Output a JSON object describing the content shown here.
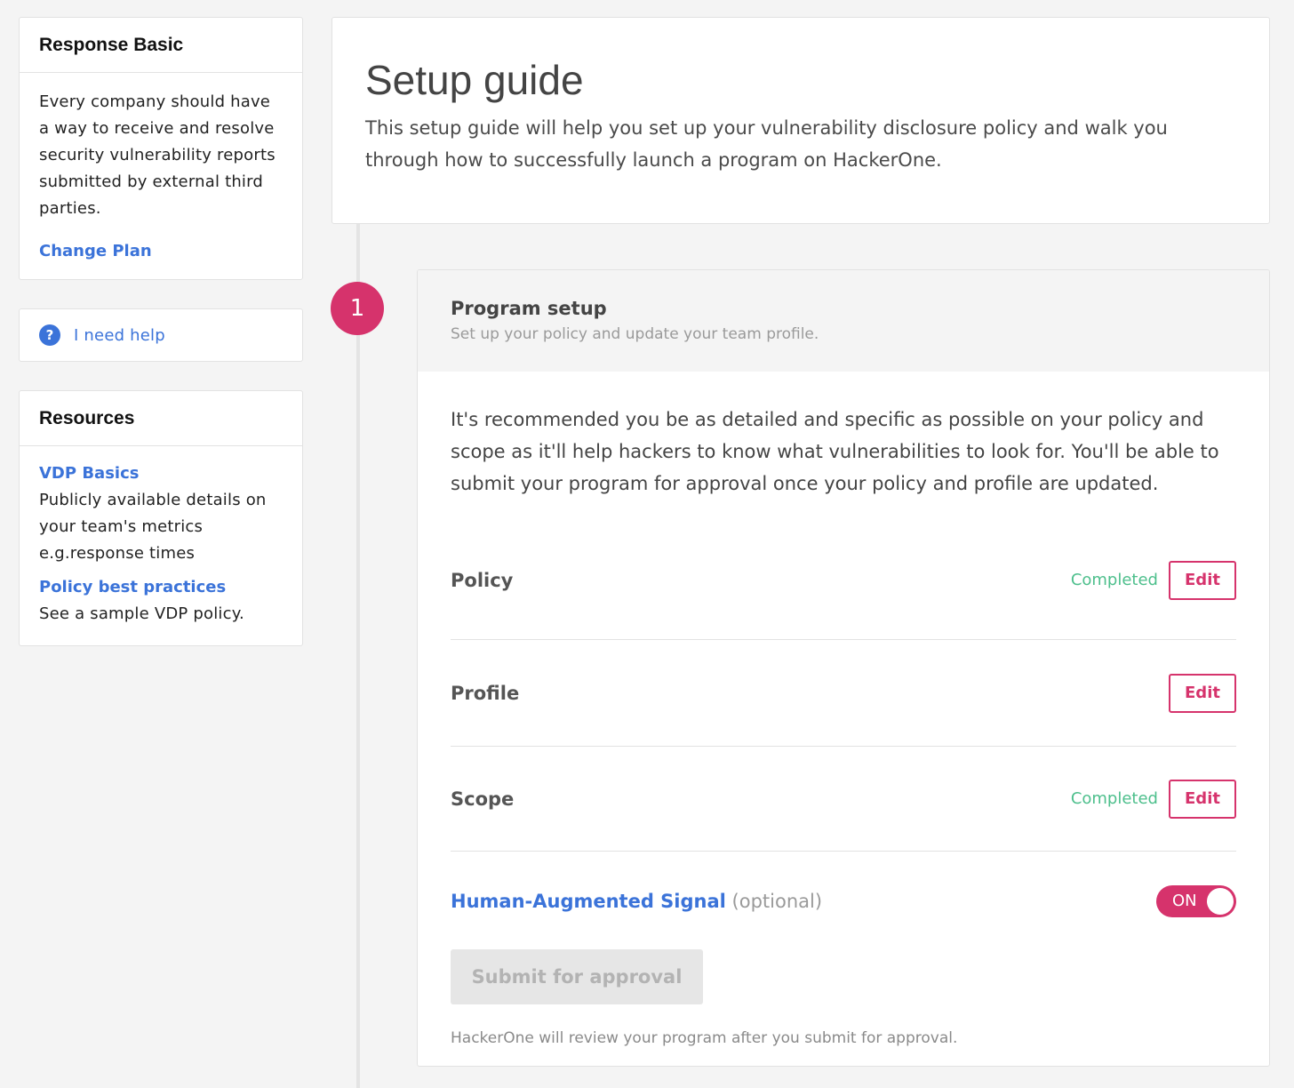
{
  "sidebar": {
    "plan": {
      "title": "Response Basic",
      "description": "Every company should have a way to receive and resolve security vulnerability reports submitted by external third parties.",
      "change_label": "Change Plan"
    },
    "help": {
      "icon": "question-circle-icon",
      "icon_glyph": "?",
      "label": "I need help"
    },
    "resources": {
      "title": "Resources",
      "items": [
        {
          "label": "VDP Basics",
          "description": "Publicly available details on your team's metrics e.g.response times"
        },
        {
          "label": "Policy best practices",
          "description": "See a sample VDP policy."
        }
      ]
    }
  },
  "main": {
    "title": "Setup guide",
    "intro": "This setup guide will help you set up your vulnerability disclosure policy and walk you through how to successfully launch a program on HackerOne.",
    "step": {
      "number": "1",
      "title": "Program setup",
      "subtitle": "Set up your policy and update your team profile.",
      "description": "It's recommended you be as detailed and specific as possible on your policy and scope as it'll help hackers to know what vulnerabilities to look for. You'll be able to submit your program for approval once your policy and profile are updated.",
      "tasks": [
        {
          "name": "Policy",
          "status": "Completed",
          "action": "Edit"
        },
        {
          "name": "Profile",
          "status": "",
          "action": "Edit"
        },
        {
          "name": "Scope",
          "status": "Completed",
          "action": "Edit"
        }
      ],
      "signal": {
        "label": "Human-Augmented Signal",
        "optional": "(optional)",
        "toggle_label": "ON",
        "enabled": true
      },
      "submit_label": "Submit for approval",
      "footnote": "HackerOne will review your program after you submit for approval."
    }
  },
  "colors": {
    "accent": "#d6336c",
    "link": "#3b73d9",
    "success": "#4dbf8c",
    "background": "#f4f4f4"
  }
}
